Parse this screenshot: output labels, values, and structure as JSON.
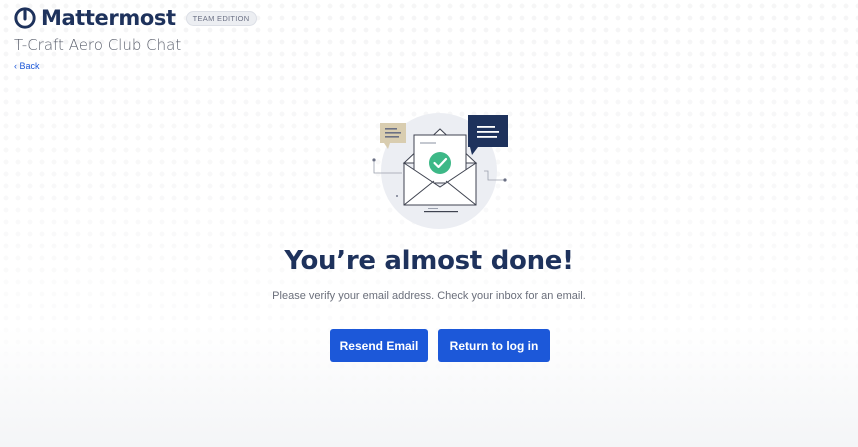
{
  "brand": {
    "name": "Mattermost",
    "edition": "TEAM EDITION"
  },
  "site": {
    "name": "T-Craft Aero Club Chat"
  },
  "nav": {
    "back_label": "Back"
  },
  "main": {
    "title": "You’re almost done!",
    "subtitle": "Please verify your email address. Check your inbox for an email.",
    "resend_label": "Resend Email",
    "return_label": "Return to log in"
  },
  "colors": {
    "brand": "#1e325c",
    "accent": "#1c58d9",
    "success": "#3db887"
  },
  "icons": [
    "mattermost-logo-icon",
    "chevron-left-icon",
    "email-verification-illustration",
    "check-icon"
  ]
}
